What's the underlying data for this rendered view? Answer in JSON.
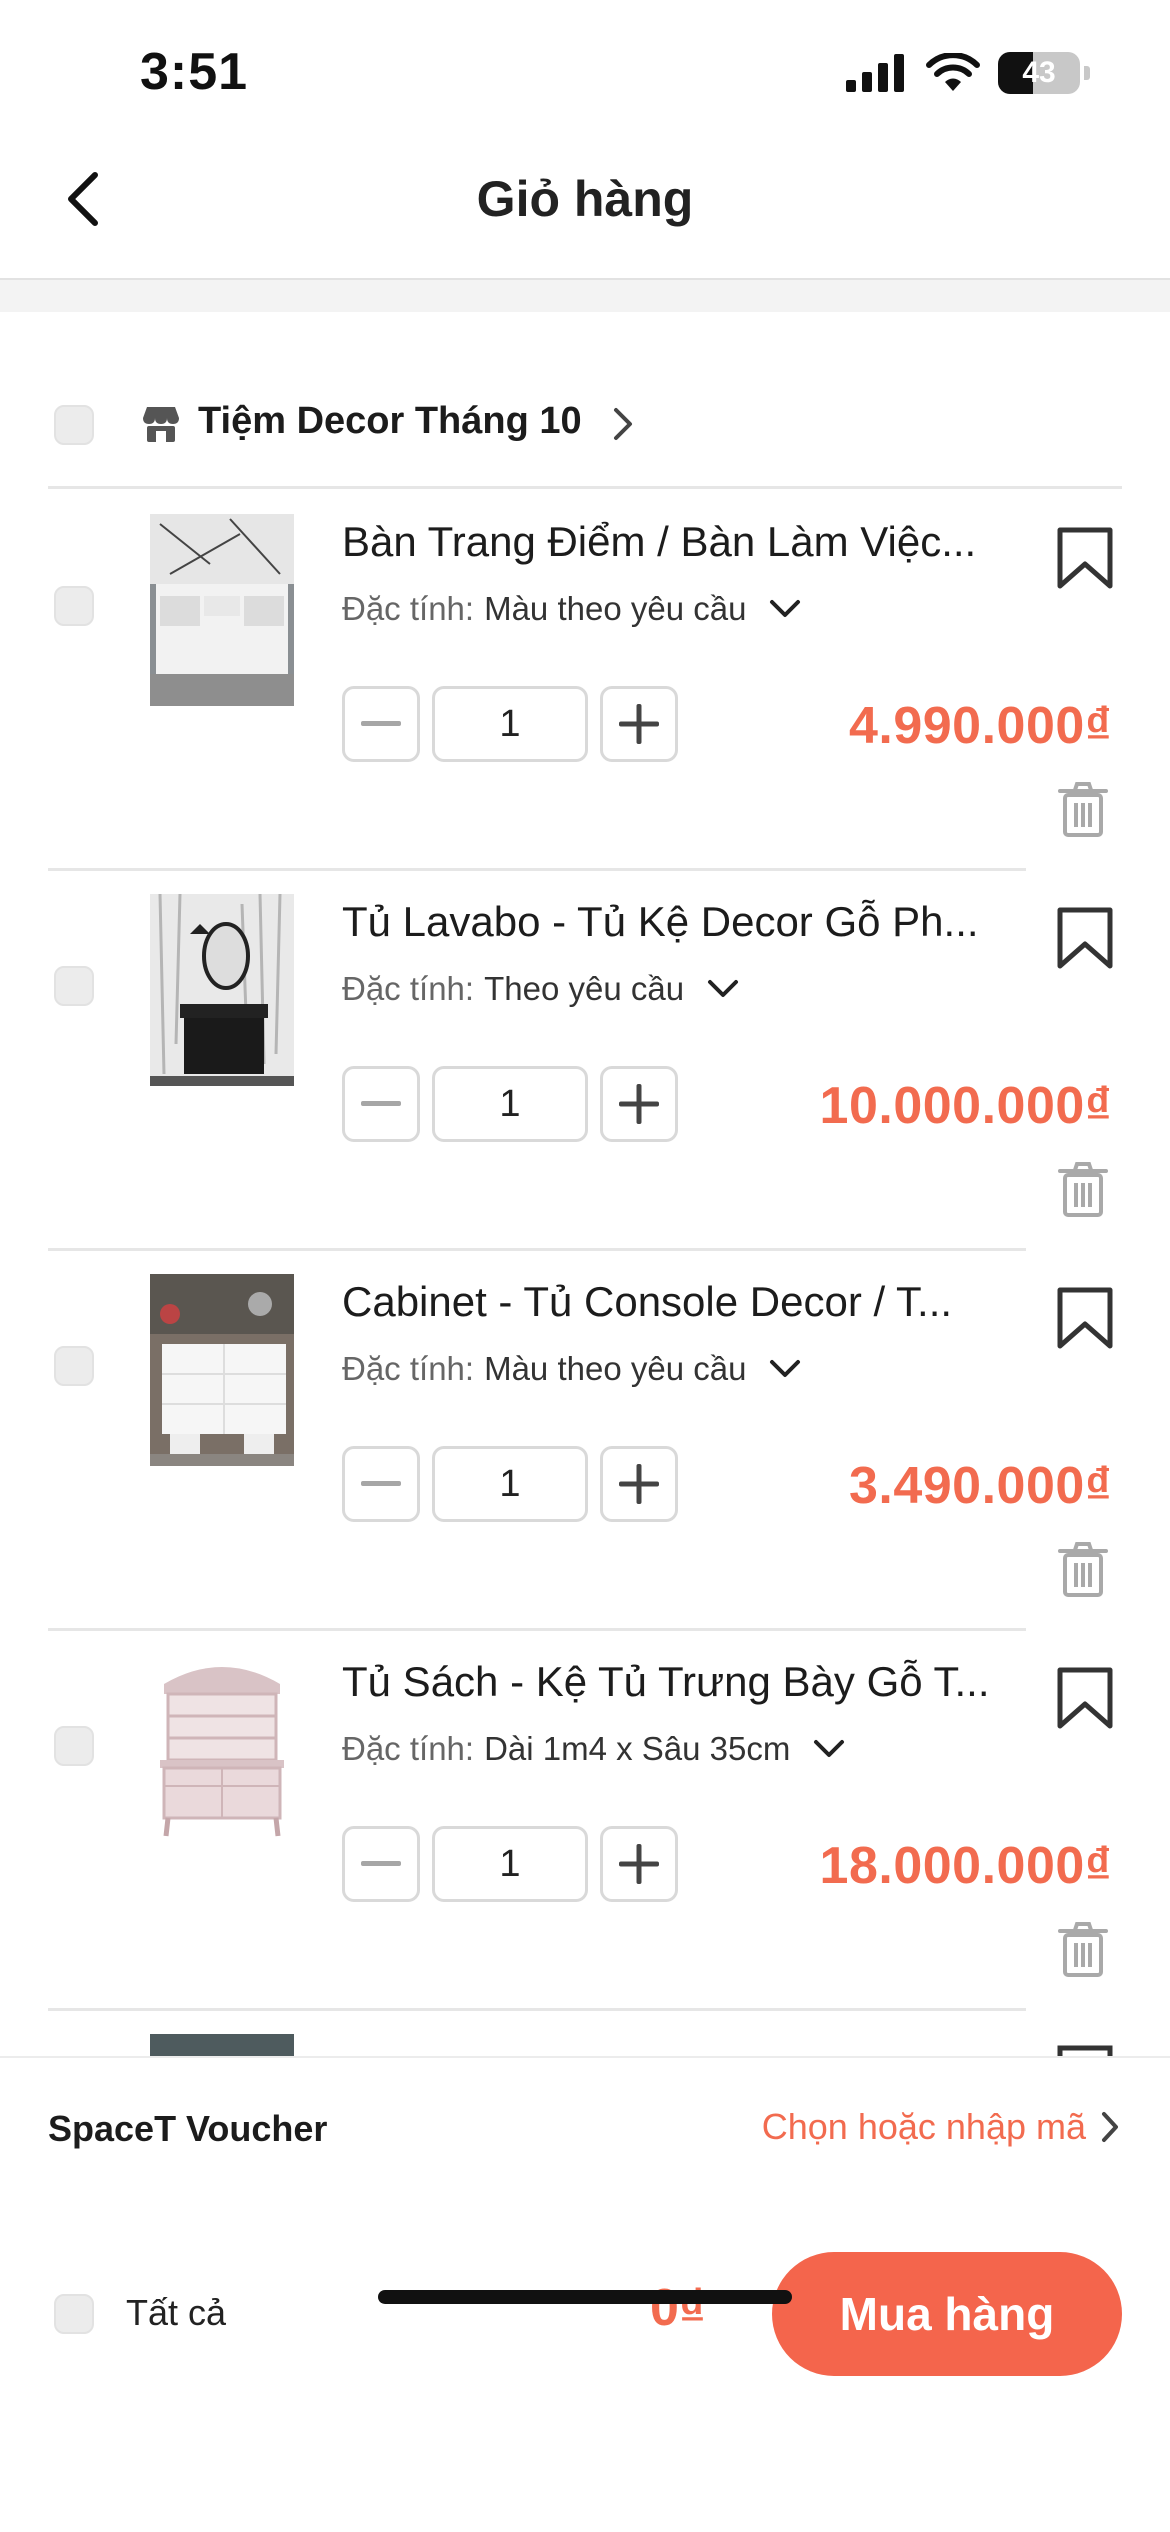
{
  "status_bar": {
    "time": "3:51",
    "battery": "43"
  },
  "header": {
    "title": "Giỏ hàng"
  },
  "shop": {
    "name": "Tiệm Decor Tháng 10"
  },
  "variant_label": "Đặc tính:",
  "items": [
    {
      "name": "Bàn Trang Điểm / Bàn Làm Việc...",
      "variant": "Màu theo yêu cầu",
      "quantity": "1",
      "price": "4.990.000₫"
    },
    {
      "name": "Tủ Lavabo - Tủ Kệ Decor Gỗ Ph...",
      "variant": "Theo yêu cầu",
      "quantity": "1",
      "price": "10.000.000₫"
    },
    {
      "name": "Cabinet - Tủ Console Decor / T...",
      "variant": "Màu theo yêu cầu",
      "quantity": "1",
      "price": "3.490.000₫"
    },
    {
      "name": "Tủ Sách - Kệ Tủ Trưng Bày Gỗ T...",
      "variant": "Dài 1m4 x Sâu 35cm",
      "quantity": "1",
      "price": "18.000.000₫"
    }
  ],
  "voucher": {
    "label": "SpaceT Voucher",
    "action": "Chọn hoặc nhập mã"
  },
  "footer": {
    "select_all": "Tất cả",
    "total": "0₫",
    "buy_label": "Mua hàng"
  },
  "colors": {
    "accent": "#f26b4f",
    "button": "#f4654c"
  }
}
